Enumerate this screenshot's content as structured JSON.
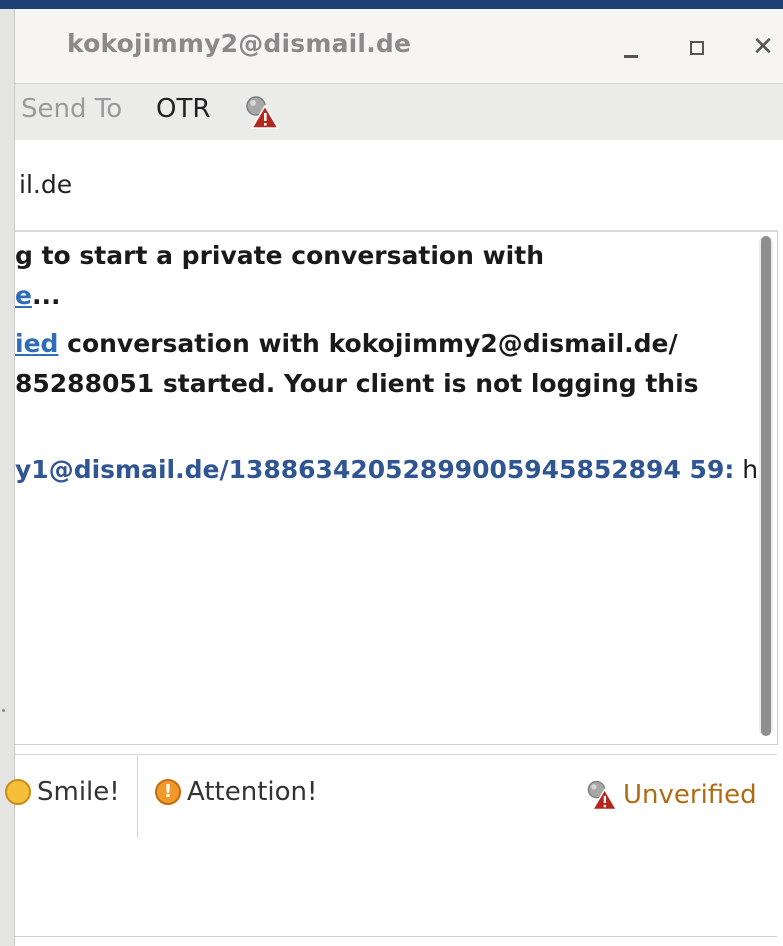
{
  "window": {
    "title": "kokojimmy2@dismail.de",
    "controls": {
      "minimize": "minimize",
      "maximize": "maximize",
      "close": "✕"
    }
  },
  "toolbar": {
    "send_to": "Send To",
    "otr": "OTR",
    "otr_status_icon": "unverified-warning-icon"
  },
  "recipient": {
    "text": "il.de"
  },
  "history": {
    "line1": "g to start a private conversation with",
    "line1b_link": "e",
    "line1b_rest": "...",
    "line2_link": "ied",
    "line2_rest": " conversation with kokojimmy2@dismail.de/",
    "line3": "85288051 started.  Your client is not logging this",
    "msg_sender": "y1@dismail.de/13886342052899005945852894 59:",
    "msg_text": " hi"
  },
  "format_bar": {
    "smile_label": "Smile!",
    "attention_label": "Attention!",
    "attention_glyph": "!",
    "otr_status_label": "Unverified"
  },
  "colors": {
    "title_strip": "#1d3f73",
    "link": "#2f6db8",
    "sender": "#2f5592",
    "unverified": "#b06c13",
    "warning_red": "#b5261e"
  }
}
